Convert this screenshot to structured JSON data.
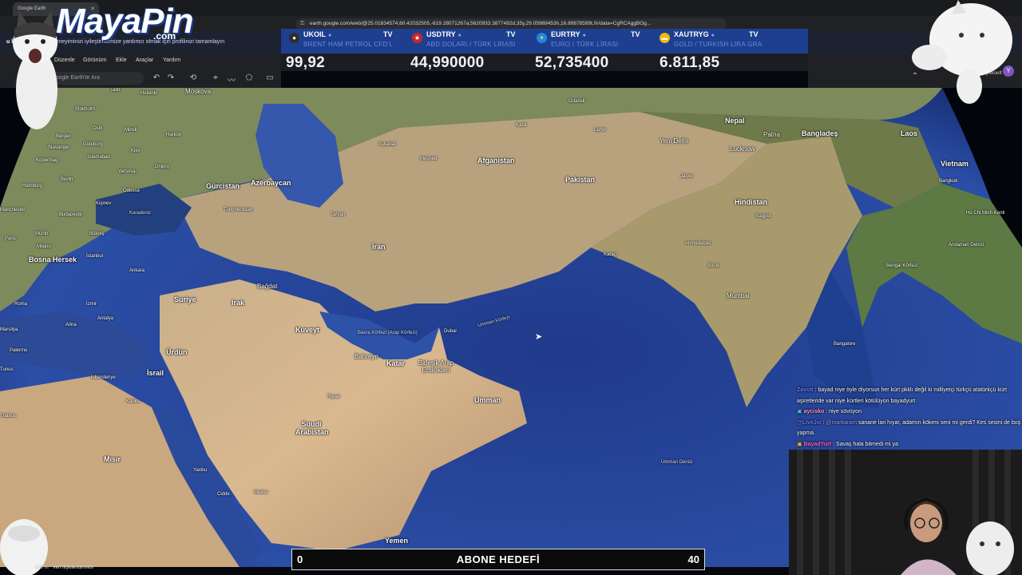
{
  "browser": {
    "tab_title": "Google Earth",
    "url": "earth.google.com/web/@25.01834574,60.42032505,-619.28071267a,5620933.3877492d,35y,29.05969453h,16.89878599t,0r/data=CgRCAggBOg..."
  },
  "infobar": {
    "lead": "u kişiselleştirin",
    "text": "Deneyiminizi iyileştirmemize yardımcı olmak için profilinizi tamamlayın"
  },
  "overlay_logo": {
    "name": "MayaPin",
    "suffix": ".com"
  },
  "ticker": [
    {
      "symbol": "UKOIL",
      "desc": "BRENT HAM PETROL CFD'L",
      "value": "99,92",
      "icon": "oil-drop-icon",
      "color": "#2d2d2d"
    },
    {
      "symbol": "USDTRY",
      "desc": "ABD DOLARI / TÜRK LİRASI",
      "value": "44,990000",
      "icon": "us-flag-icon",
      "color": "#c62828"
    },
    {
      "symbol": "EURTRY",
      "desc": "EURO / TÜRK LİRASI",
      "value": "52,735400",
      "icon": "eu-flag-icon",
      "color": "#1e88e5"
    },
    {
      "symbol": "XAUTRYG",
      "desc": "GOLD / TURKISH LIRA GRA",
      "value": "6.811,85",
      "icon": "gold-icon",
      "color": "#f2b705"
    }
  ],
  "earth": {
    "menus": [
      "Düzenle",
      "Görünüm",
      "Ekle",
      "Araçlar",
      "Yardım"
    ],
    "search_placeholder": "Google Earth'te Ara",
    "upgrade_text": "Sürümü yükselt",
    "avatar": "Y",
    "footer_link": "Veri İlişkilendirmesi",
    "scale_text": "100 m"
  },
  "map_labels": {
    "countries": [
      "Gürcistan",
      "Azerbaycan",
      "Afganistan",
      "Pakistan",
      "Nepal",
      "Bangladeş",
      "Laos",
      "Vietnam",
      "Hindistan",
      "İran",
      "Irak",
      "Suriye",
      "Ürdün",
      "İsrail",
      "Kuveyt",
      "Bahreyn",
      "Katar",
      "Birleşik Arap Emirlikleri",
      "Umman",
      "Suudi Arabistan",
      "Mısır",
      "Yemen",
      "Türkmenistan",
      "Bosna Hersek"
    ],
    "cities": [
      "Talin",
      "Helsinki",
      "Moskova",
      "Stokholm",
      "Oslo",
      "Göteborg",
      "Kopenhag",
      "Hamburg",
      "Berlin",
      "Varşova",
      "Kiev",
      "Harkov",
      "Minsk",
      "Kişinev",
      "Odessa",
      "Budapeşte",
      "Bükreş",
      "İstanbul",
      "Ankara",
      "Roma",
      "İzmir",
      "Atina",
      "Antalya",
      "Palermo",
      "İskenderiye",
      "Kahire",
      "Bağdat",
      "Tahran",
      "Aşkabat",
      "Meşhed",
      "Kabil",
      "Lahor",
      "Yeni Delhi",
      "Lucknow",
      "Patna",
      "Jaipur",
      "Ahmedabad",
      "Nagpur",
      "Karaçi",
      "Surat",
      "Mumbai",
      "Bangalore",
      "Bangkok",
      "Ho Chi Minh Kenti",
      "Dubai",
      "Riyad",
      "Cidde",
      "Mekke",
      "Trablus",
      "Yanbu",
      "Bergen",
      "Stavanger",
      "Dnipro",
      "Manchester",
      "Paris",
      "Münih",
      "Milano",
      "Marsilya",
      "Tunus",
      "Gdansk",
      "Islamabad"
    ],
    "seas": [
      "Basra Körfezi (Arap Körfezi)",
      "Umman Körfezi",
      "Umman Denizi",
      "Bengal Körfezi",
      "Karadeniz",
      "Andaman Denizi"
    ]
  },
  "chat": [
    {
      "user": "Zavoti",
      "text": "bayad niye öyle diyorsun her kürt pkklı değil ki milliyetçi türkçü atatürkçü kürt aşiretleride var niye kürtleri kötülüyon bayadyurt",
      "color": "#6f7fff"
    },
    {
      "user": "aycisko",
      "text": "niye sövüyon",
      "color": "#ff9acb"
    },
    {
      "user": "@LiveJix",
      "text": "sanane lan hıyar, adamın kökeni seni mi gerdi? Kes sesini de boş yapma.",
      "color": "#6f7fff",
      "mention": "@markaram"
    },
    {
      "user": "BayadYurt",
      "text": "Savaş hala bitmedi mi ya",
      "color": "#ff66cc"
    }
  ],
  "goal": {
    "title": "ABONE HEDEFİ",
    "current": "0",
    "target": "40"
  }
}
